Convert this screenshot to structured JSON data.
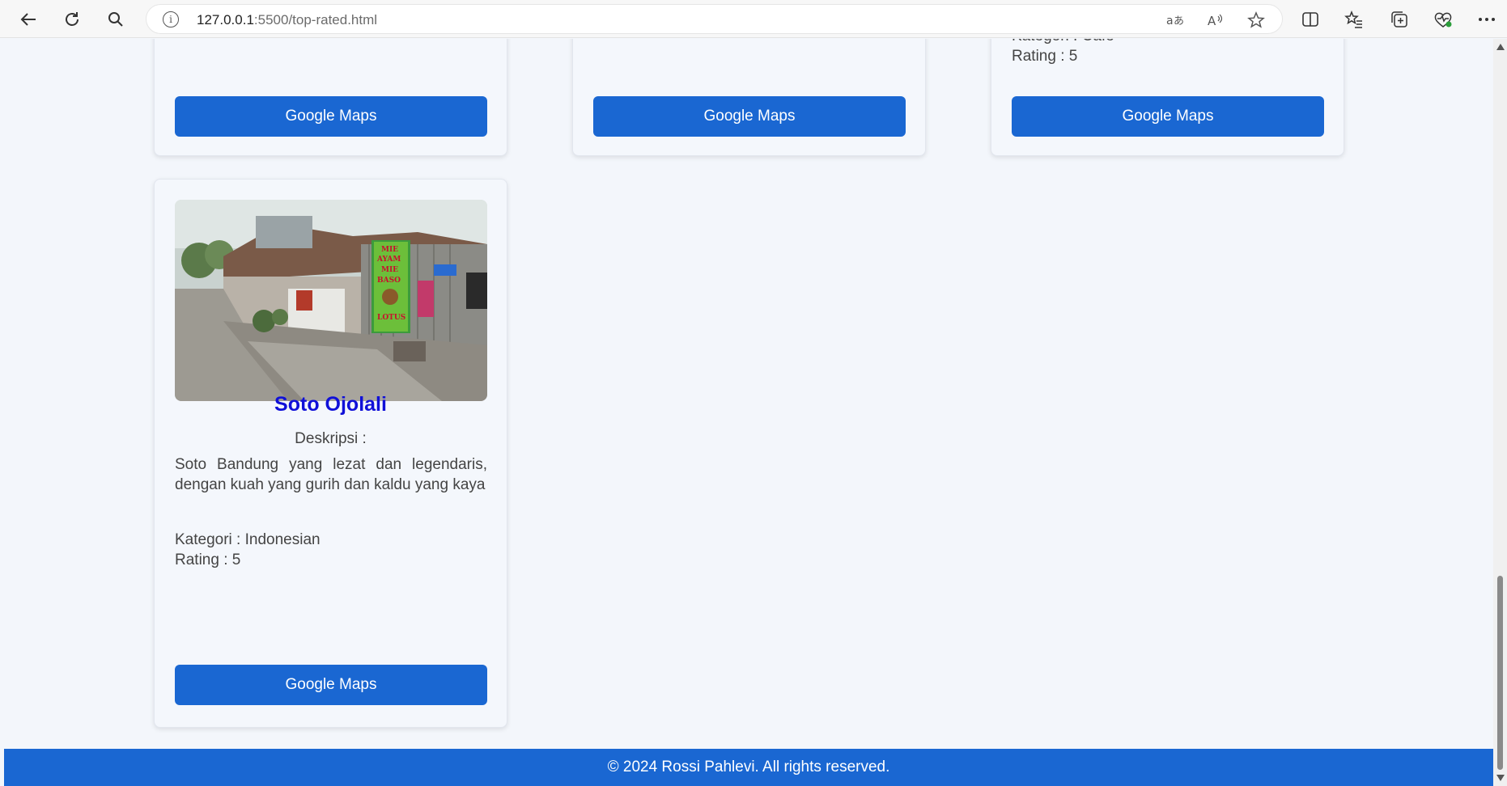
{
  "browser": {
    "url_host": "127.0.0.1",
    "url_path": ":5500/top-rated.html",
    "info_glyph": "i"
  },
  "cards_top": [
    {
      "partial_text": "",
      "button_label": "Google Maps"
    },
    {
      "partial_text": "",
      "button_label": "Google Maps"
    },
    {
      "partial_category": "Kategori : Cafe",
      "rating": "Rating : 5",
      "button_label": "Google Maps"
    }
  ],
  "card_main": {
    "title": "Soto Ojolali",
    "desc_label": "Deskripsi :",
    "description": "Soto Bandung yang lezat dan legendaris, dengan kuah yang gurih dan kaldu yang kaya",
    "category": "Kategori : Indonesian",
    "rating": "Rating : 5",
    "button_label": "Google Maps",
    "photo_sign": [
      "MIE",
      "AYAM",
      "MIE",
      "BASO",
      "LOTUS"
    ]
  },
  "footer": {
    "text": "© 2024 Rossi Pahlevi. All rights reserved."
  },
  "colors": {
    "accent": "#1a67d2",
    "title": "#1010d8",
    "background": "#f3f6fb"
  },
  "icons": [
    "back-arrow-icon",
    "refresh-icon",
    "search-icon",
    "info-icon",
    "translate-icon",
    "read-aloud-icon",
    "favorite-star-icon",
    "split-screen-icon",
    "favorites-icon",
    "collections-icon",
    "browser-essentials-icon",
    "more-icon"
  ]
}
